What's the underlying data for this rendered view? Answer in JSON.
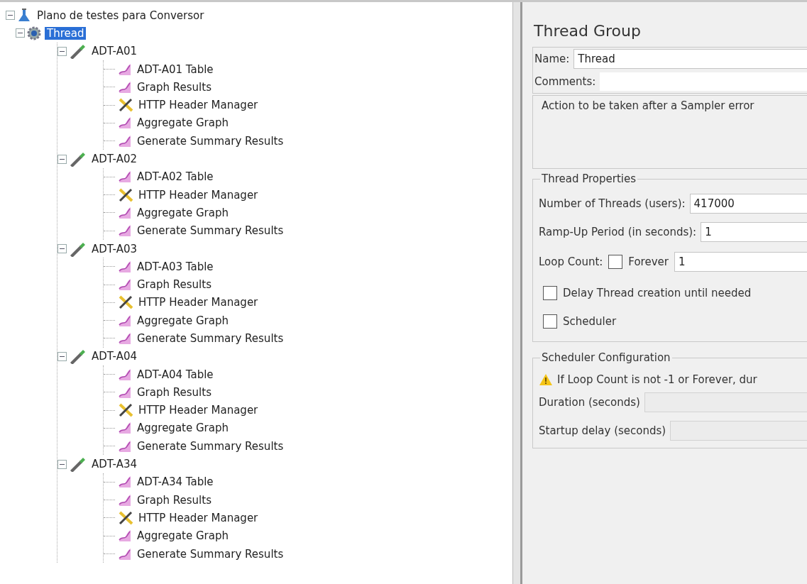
{
  "tree": {
    "label": "Plano de testes para Conversor",
    "kind": "plan",
    "expanded": true,
    "selected": false,
    "children": [
      {
        "label": "Thread",
        "kind": "thread_group",
        "expanded": true,
        "selected": true,
        "children": [
          {
            "label": "ADT-A01",
            "kind": "controller",
            "expanded": true,
            "selected": false,
            "children": [
              {
                "label": "ADT-A01 Table",
                "kind": "listener",
                "selected": false
              },
              {
                "label": "Graph Results",
                "kind": "listener",
                "selected": false
              },
              {
                "label": "HTTP Header Manager",
                "kind": "config",
                "selected": false
              },
              {
                "label": "Aggregate Graph",
                "kind": "listener",
                "selected": false
              },
              {
                "label": "Generate Summary Results",
                "kind": "listener",
                "selected": false
              }
            ]
          },
          {
            "label": "ADT-A02",
            "kind": "controller",
            "expanded": true,
            "selected": false,
            "children": [
              {
                "label": "ADT-A02 Table",
                "kind": "listener",
                "selected": false
              },
              {
                "label": "HTTP Header Manager",
                "kind": "config",
                "selected": false
              },
              {
                "label": "Aggregate Graph",
                "kind": "listener",
                "selected": false
              },
              {
                "label": "Generate Summary Results",
                "kind": "listener",
                "selected": false
              }
            ]
          },
          {
            "label": "ADT-A03",
            "kind": "controller",
            "expanded": true,
            "selected": false,
            "children": [
              {
                "label": "ADT-A03 Table",
                "kind": "listener",
                "selected": false
              },
              {
                "label": "Graph Results",
                "kind": "listener",
                "selected": false
              },
              {
                "label": "HTTP Header Manager",
                "kind": "config",
                "selected": false
              },
              {
                "label": "Aggregate Graph",
                "kind": "listener",
                "selected": false
              },
              {
                "label": "Generate Summary Results",
                "kind": "listener",
                "selected": false
              }
            ]
          },
          {
            "label": "ADT-A04",
            "kind": "controller",
            "expanded": true,
            "selected": false,
            "children": [
              {
                "label": "ADT-A04 Table",
                "kind": "listener",
                "selected": false
              },
              {
                "label": "Graph Results",
                "kind": "listener",
                "selected": false
              },
              {
                "label": "HTTP Header Manager",
                "kind": "config",
                "selected": false
              },
              {
                "label": "Aggregate Graph",
                "kind": "listener",
                "selected": false
              },
              {
                "label": "Generate Summary Results",
                "kind": "listener",
                "selected": false
              }
            ]
          },
          {
            "label": "ADT-A34",
            "kind": "controller",
            "expanded": true,
            "selected": false,
            "children": [
              {
                "label": "ADT-A34 Table",
                "kind": "listener",
                "selected": false
              },
              {
                "label": "Graph Results",
                "kind": "listener",
                "selected": false
              },
              {
                "label": "HTTP Header Manager",
                "kind": "config",
                "selected": false
              },
              {
                "label": "Aggregate Graph",
                "kind": "listener",
                "selected": false
              },
              {
                "label": "Generate Summary Results",
                "kind": "listener",
                "selected": false
              }
            ]
          }
        ]
      }
    ]
  },
  "panel": {
    "title": "Thread Group",
    "name": {
      "label": "Name:",
      "value": "Thread"
    },
    "comments": {
      "label": "Comments:"
    },
    "error_action": {
      "legend": "Action to be taken after a Sampler error"
    },
    "thread_properties": {
      "legend": "Thread Properties",
      "threads": {
        "label": "Number of Threads (users):",
        "value": "417000"
      },
      "ramp_up": {
        "label": "Ramp-Up Period (in seconds):",
        "value": "1"
      },
      "loop_count": {
        "label": "Loop Count:",
        "forever_label": "Forever",
        "forever_checked": false,
        "value": "1"
      },
      "delay": {
        "label": "Delay Thread creation until needed",
        "checked": false
      },
      "scheduler": {
        "label": "Scheduler",
        "checked": false
      }
    },
    "scheduler_config": {
      "legend": "Scheduler Configuration",
      "warning": "If Loop Count is not -1 or Forever, dur",
      "duration": {
        "label": "Duration (seconds)",
        "disabled": true
      },
      "startup_delay": {
        "label": "Startup delay (seconds)",
        "disabled": true
      }
    }
  }
}
